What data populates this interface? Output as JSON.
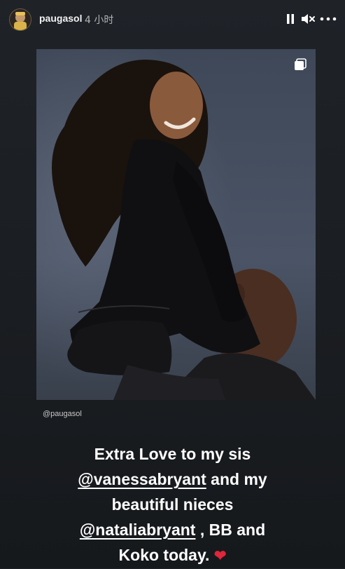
{
  "header": {
    "username": "paugasol",
    "timestamp": "4 小时",
    "controls": [
      "pause-icon",
      "mute-icon",
      "more-icon"
    ]
  },
  "post": {
    "credit": "@paugasol",
    "icon": "gallery-icon",
    "caption": {
      "line1": "Extra Love to my sis",
      "mention1": "@vanessabryant",
      "line2_rest": " and my",
      "line3": "beautiful nieces",
      "mention2": "@nataliabryant",
      "line4_rest": " , BB and",
      "line5": "Koko today.",
      "heart": "❤"
    }
  },
  "colors": {
    "background": "#1c1f23",
    "photo_background": "#3a4350",
    "heart": "#e0263a"
  }
}
